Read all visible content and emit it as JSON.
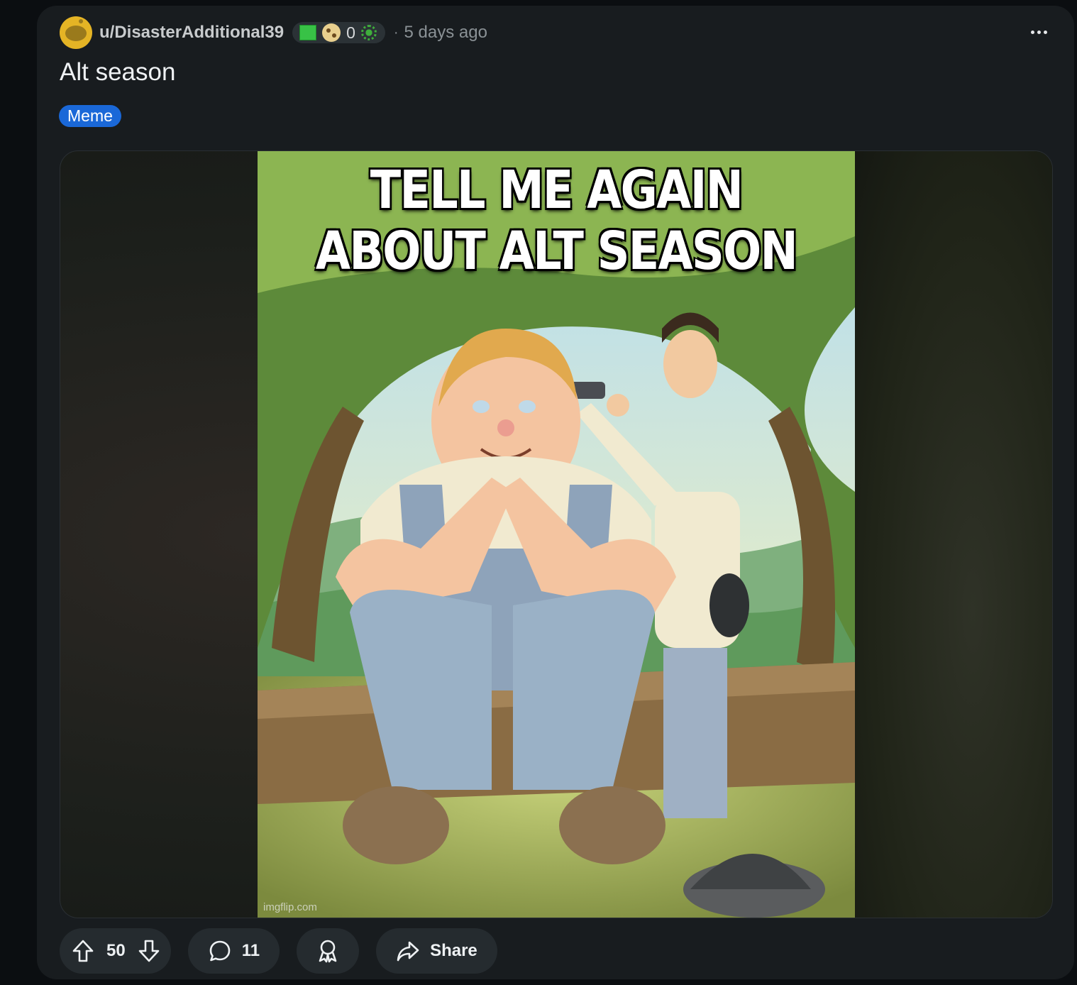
{
  "post": {
    "username": "u/DisasterAdditional39",
    "flair_count": "0",
    "separator": "·",
    "time_ago": "5 days ago",
    "title": "Alt season",
    "tag": "Meme"
  },
  "meme": {
    "line1": "TELL ME AGAIN",
    "line2": "ABOUT ALT SEASON",
    "watermark": "imgflip.com"
  },
  "actions": {
    "score": "50",
    "comments": "11",
    "share_label": "Share"
  },
  "icons": [
    "more-options-icon",
    "upvote-icon",
    "downvote-icon",
    "comment-icon",
    "award-icon",
    "share-icon"
  ],
  "colors": {
    "card_bg": "#181c1f",
    "page_bg": "#0b0e11",
    "tag_bg": "#1a68d8",
    "pill_bg": "#252b2f"
  }
}
